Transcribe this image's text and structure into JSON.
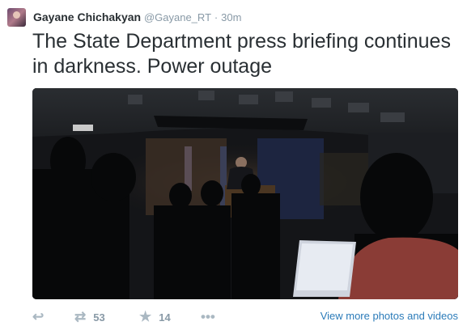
{
  "tweet": {
    "author_name": "Gayane Chichakyan",
    "handle": "@Gayane_RT",
    "separator": "·",
    "time": "30m",
    "text": "The State Department press briefing continues in darkness. Power outage"
  },
  "actions": {
    "retweet_count": "53",
    "favorite_count": "14",
    "view_more_label": "View more photos and videos"
  },
  "icons": {
    "reply": "reply-icon",
    "retweet": "retweet-icon",
    "favorite": "star-icon",
    "more": "more-icon"
  },
  "colors": {
    "link": "#2b7bb9",
    "muted": "#8899a6",
    "text": "#292f33"
  }
}
